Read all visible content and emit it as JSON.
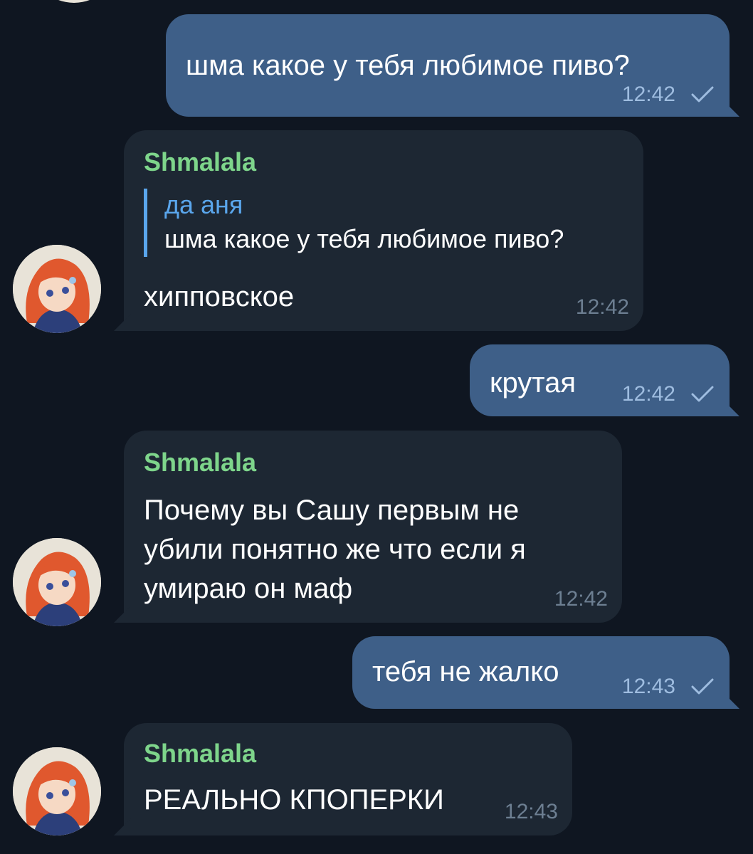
{
  "colors": {
    "background": "#0f1621",
    "outgoing_bubble": "#3e5f88",
    "incoming_bubble": "#1d2733",
    "sender_name": "#7ed58b",
    "reply_accent": "#5aa6ec"
  },
  "messages": [
    {
      "direction": "outgoing",
      "text": "шма какое у тебя любимое пиво?",
      "time": "12:42",
      "status_icon": "check-icon"
    },
    {
      "direction": "incoming",
      "sender": "Shmalala",
      "reply_to": {
        "author": "да аня",
        "text": "шма какое у тебя любимое пиво?"
      },
      "text": "хипповское",
      "time": "12:42",
      "avatar_icon": "avatar-icon"
    },
    {
      "direction": "outgoing",
      "text": "крутая",
      "time": "12:42",
      "status_icon": "check-icon"
    },
    {
      "direction": "incoming",
      "sender": "Shmalala",
      "text_lines": [
        "Почему вы Сашу первым не",
        "убили понятно же что если я",
        "умираю он маф"
      ],
      "time": "12:42",
      "avatar_icon": "avatar-icon"
    },
    {
      "direction": "outgoing",
      "text": "тебя не жалко",
      "time": "12:43",
      "status_icon": "check-icon"
    },
    {
      "direction": "incoming",
      "sender": "Shmalala",
      "text": "РЕАЛЬНО КПОПЕРКИ",
      "time": "12:43",
      "avatar_icon": "avatar-icon"
    }
  ]
}
